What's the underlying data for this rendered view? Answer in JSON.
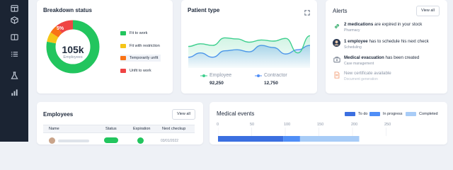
{
  "colors": {
    "sidebar": "#1b2433",
    "green": "#22c55e",
    "yellow": "#f5c518",
    "orange": "#f97316",
    "red": "#ef4444",
    "blue": "#3b6fe0",
    "blue_mid": "#4f8ef7",
    "blue_light": "#a8ccf7"
  },
  "sidebar": {
    "items": [
      {
        "icon": "calendar-icon"
      },
      {
        "icon": "cube-icon"
      },
      {
        "icon": "book-icon"
      },
      {
        "icon": "list-icon"
      },
      {
        "icon": "flask-icon"
      },
      {
        "icon": "bar-chart-icon"
      }
    ]
  },
  "breakdown": {
    "title": "Breakdown status",
    "center_value": "105k",
    "center_label": "Employees",
    "highlight_label": "5%",
    "segments": [
      {
        "label": "Fit to work",
        "color": "#22c55e",
        "share": 0.78
      },
      {
        "label": "Fit with restriction",
        "color": "#f5c518",
        "share": 0.06
      },
      {
        "label": "Temporarily unfit",
        "color": "#f97316",
        "share": 0.05
      },
      {
        "label": "Unfit to work",
        "color": "#ef4444",
        "share": 0.11
      }
    ]
  },
  "patient_type": {
    "title": "Patient type",
    "expand_icon": "expand-icon",
    "series": [
      {
        "name": "Employee",
        "value": "92,250",
        "color": "#3ecf8e",
        "values": [
          60,
          55,
          58,
          44,
          46,
          52,
          48,
          50,
          45,
          72,
          40
        ]
      },
      {
        "name": "Contractor",
        "value": "12,750",
        "color": "#4f8ef7",
        "values": [
          80,
          72,
          80,
          68,
          66,
          70,
          58,
          62,
          74,
          66,
          58
        ]
      }
    ]
  },
  "alerts": {
    "title": "Alerts",
    "view_all": "View all",
    "items": [
      {
        "icon": "link-icon",
        "bold": "2 medications",
        "text": " are expired in your stock",
        "sub": "Pharmacy",
        "muted": false
      },
      {
        "icon": "avatar-icon",
        "bold": "1 employee",
        "text": " has to schedule his next check",
        "sub": "Scheduling",
        "muted": false
      },
      {
        "icon": "case-icon",
        "bold": "Medical evacuation",
        "text": " has been created",
        "sub": "Case management",
        "muted": false
      },
      {
        "icon": "document-icon",
        "bold": "",
        "text": "New certificate available",
        "sub": "Document generation",
        "muted": true
      }
    ]
  },
  "employees": {
    "title": "Employees",
    "view_all": "View all",
    "columns": [
      "Name",
      "Status",
      "Expiration",
      "Next checkup"
    ],
    "rows": [
      {
        "name": "",
        "checkup": "03/01/2022"
      }
    ]
  },
  "medical_events": {
    "title": "Medical events",
    "legend": [
      {
        "label": "To do",
        "color": "#3b6fe0"
      },
      {
        "label": "In progress",
        "color": "#4f8ef7"
      },
      {
        "label": "Completed",
        "color": "#a8ccf7"
      }
    ],
    "ticks": [
      "0",
      "50",
      "100",
      "150",
      "200",
      "250"
    ],
    "chart_data": {
      "type": "bar",
      "orientation": "horizontal-stacked",
      "xlim": [
        0,
        250
      ],
      "series": [
        {
          "name": "To do",
          "values": [
            97
          ]
        },
        {
          "name": "In progress",
          "values": [
            25
          ]
        },
        {
          "name": "Completed",
          "values": [
            88
          ]
        }
      ]
    }
  }
}
